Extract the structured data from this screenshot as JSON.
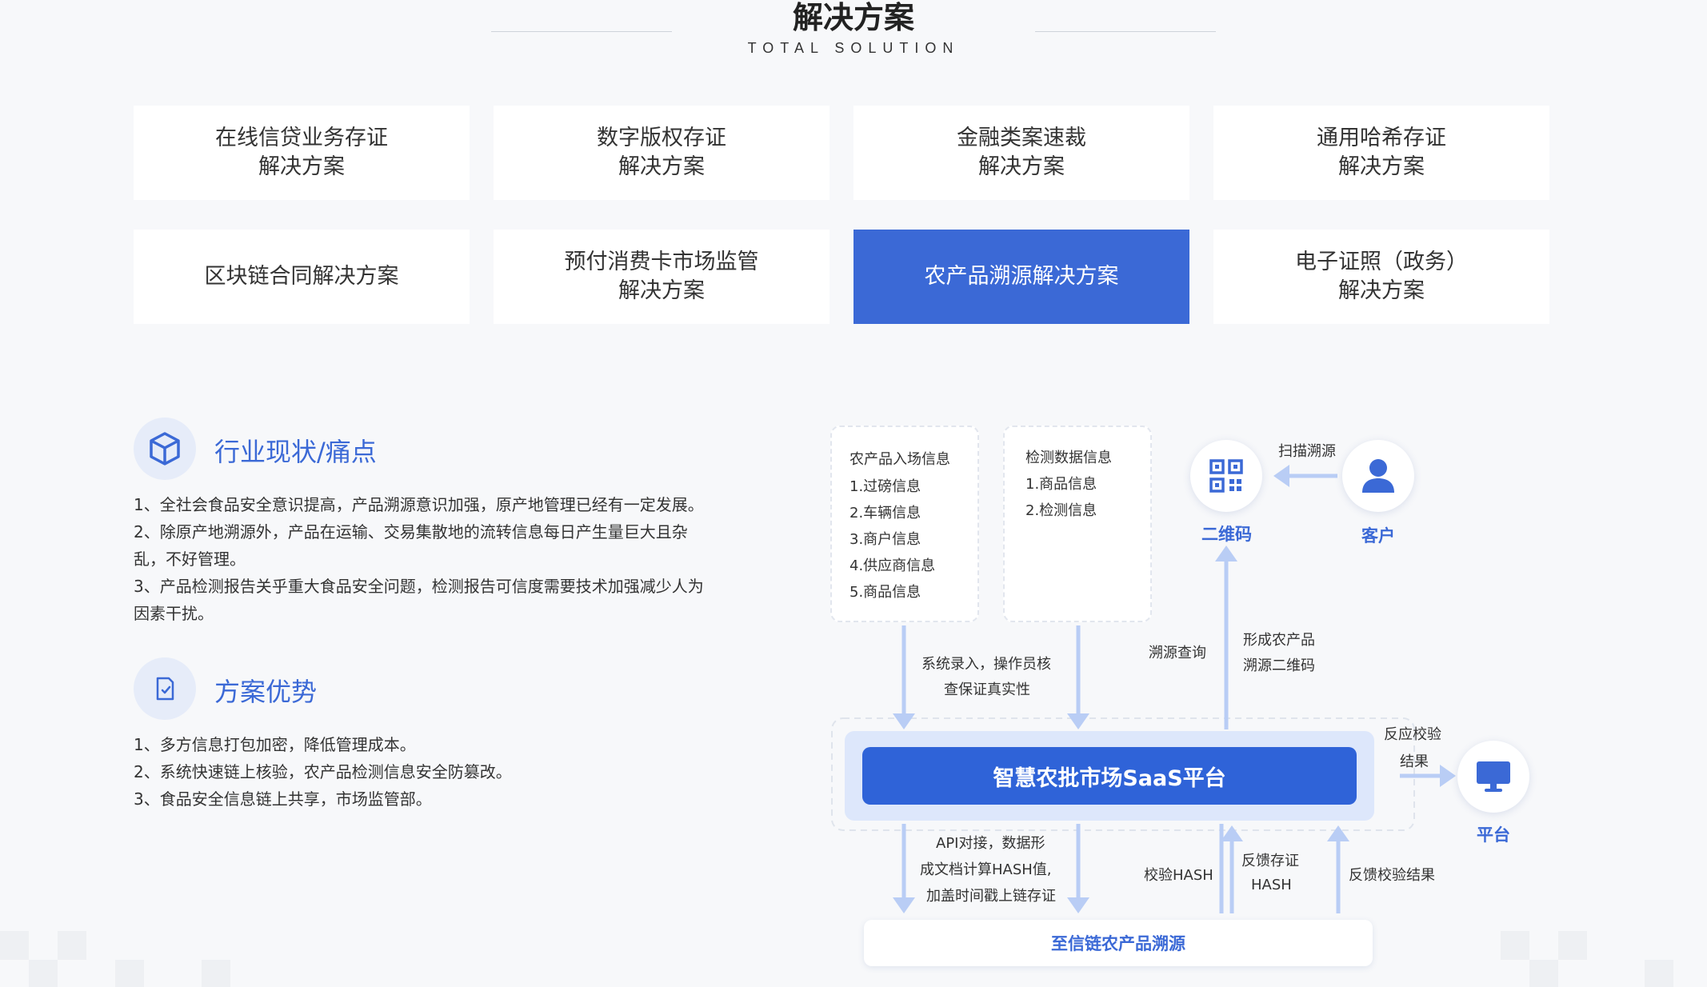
{
  "header": {
    "title": "解决方案",
    "subtitle": "TOTAL  SOLUTION"
  },
  "tiles": [
    {
      "line1": "在线信贷业务存证",
      "line2": "解决方案"
    },
    {
      "line1": "数字版权存证",
      "line2": "解决方案"
    },
    {
      "line1": "金融类案速裁",
      "line2": "解决方案"
    },
    {
      "line1": "通用哈希存证",
      "line2": "解决方案"
    },
    {
      "line1": "区块链合同解决方案",
      "line2": ""
    },
    {
      "line1": "预付消费卡市场监管",
      "line2": "解决方案"
    },
    {
      "line1": "农产品溯源解决方案",
      "line2": ""
    },
    {
      "line1": "电子证照（政务）",
      "line2": "解决方案"
    }
  ],
  "active_tile_color": "#3b69d6",
  "industry": {
    "title": "行业现状/痛点",
    "icon": "cube-icon",
    "items": [
      "1、全社会食品安全意识提高，产品溯源意识加强，原产地管理已经有一定发展。",
      "2、除原产地溯源外，产品在运输、交易集散地的流转信息每日产生量巨大且杂",
      "乱，不好管理。",
      "3、产品检测报告关乎重大食品安全问题，检测报告可信度需要技术加强减少人为",
      "因素干扰。"
    ]
  },
  "advantage": {
    "title": "方案优势",
    "icon": "document-check-icon",
    "items": [
      "1、多方信息打包加密，降低管理成本。",
      "2、系统快速链上核验，农产品检测信息安全防篡改。",
      "3、食品安全信息链上共享，市场监管部。"
    ]
  },
  "diagram": {
    "box1": {
      "title": "农产品入场信息",
      "items": [
        "1.过磅信息",
        "2.车辆信息",
        "3.商户信息",
        "4.供应商信息",
        "5.商品信息"
      ]
    },
    "box2": {
      "title": "检测数据信息",
      "items": [
        "1.商品信息",
        "2.检测信息"
      ]
    },
    "qr_label": "二维码",
    "customer_label": "客户",
    "scan_label": "扫描溯源",
    "sys_entry": [
      "系统录入，操作员核",
      "查保证真实性"
    ],
    "trace_query": "溯源查询",
    "form_qr": [
      "形成农产品",
      "溯源二维码"
    ],
    "platform_main": "智慧农批市场SaaS平台",
    "feedback_result": [
      "反应校验",
      "结果"
    ],
    "platform_label": "平台",
    "api_text": [
      "API对接，数据形",
      "成文档计算HASH值,",
      "加盖时间戳上链存证"
    ],
    "verify_hash": "校验HASH",
    "feedback_store": [
      "反馈存证",
      "HASH"
    ],
    "feedback_verify": "反馈校验结果",
    "bottom_label": "至信链农产品溯源"
  }
}
